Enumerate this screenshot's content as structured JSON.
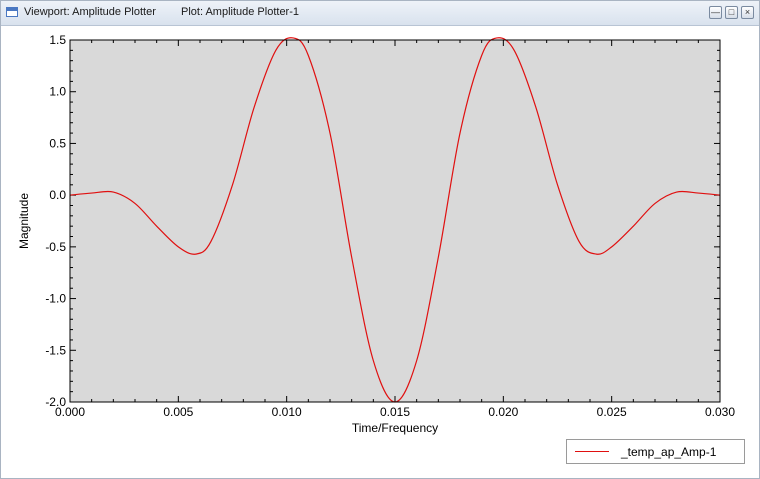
{
  "window": {
    "viewport_label": "Viewport: Amplitude Plotter",
    "plot_label": "Plot: Amplitude Plotter-1"
  },
  "colors": {
    "plot_background": "#d9d9d9",
    "series": "#e01010"
  },
  "chart_data": {
    "type": "line",
    "xlabel": "Time/Frequency",
    "ylabel": "Magnitude",
    "xlim": [
      0.0,
      0.03
    ],
    "ylim": [
      -2.0,
      1.5
    ],
    "grid": false,
    "legend_placement": "bottom-right",
    "x_ticks": [
      "0.000",
      "0.005",
      "0.010",
      "0.015",
      "0.020",
      "0.025",
      "0.030"
    ],
    "y_ticks": [
      "1.5",
      "1.0",
      "0.5",
      "0.0",
      "-0.5",
      "-1.0",
      "-1.5",
      "-2.0"
    ],
    "series": [
      {
        "name": "_temp_ap_Amp-1",
        "x": [
          0.0,
          0.001,
          0.002,
          0.003,
          0.004,
          0.005,
          0.0058,
          0.0065,
          0.0075,
          0.0085,
          0.0095,
          0.0103,
          0.011,
          0.012,
          0.013,
          0.014,
          0.015,
          0.016,
          0.017,
          0.018,
          0.019,
          0.0197,
          0.0205,
          0.0215,
          0.0225,
          0.0235,
          0.0243,
          0.025,
          0.026,
          0.027,
          0.028,
          0.029,
          0.03
        ],
        "y": [
          0.0,
          0.02,
          0.03,
          -0.08,
          -0.3,
          -0.5,
          -0.57,
          -0.45,
          0.1,
          0.85,
          1.4,
          1.52,
          1.35,
          0.6,
          -0.6,
          -1.6,
          -2.0,
          -1.6,
          -0.6,
          0.6,
          1.35,
          1.52,
          1.4,
          0.85,
          0.1,
          -0.45,
          -0.57,
          -0.5,
          -0.3,
          -0.08,
          0.03,
          0.02,
          0.0
        ]
      }
    ]
  }
}
